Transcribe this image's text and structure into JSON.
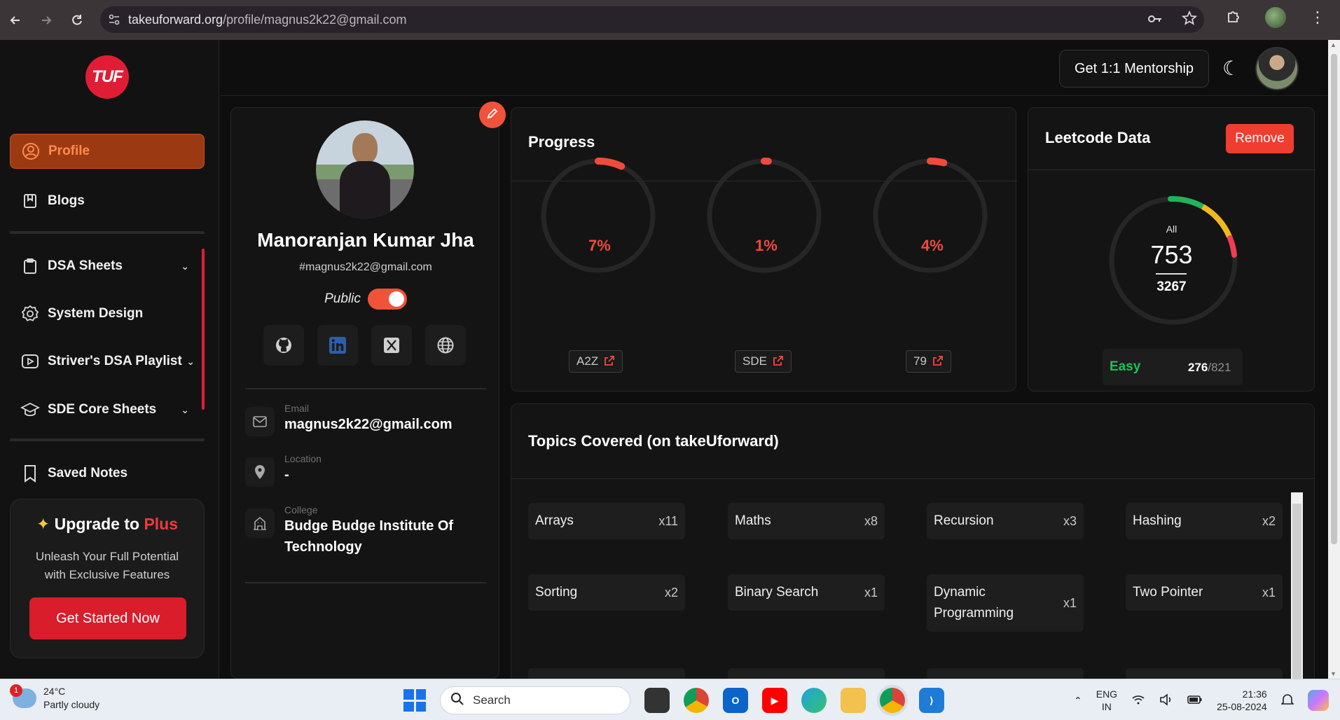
{
  "browser": {
    "url_host": "takeuforward.org",
    "url_path": "/profile/magnus2k22@gmail.com"
  },
  "sidebar": {
    "logo_text": "TUF",
    "items": [
      {
        "label": "Profile",
        "icon": "user-circle-icon"
      },
      {
        "label": "Blogs",
        "icon": "book-icon"
      },
      {
        "label": "DSA Sheets",
        "icon": "clipboard-icon"
      },
      {
        "label": "System Design",
        "icon": "gear-icon"
      },
      {
        "label": "Striver's DSA Playlist",
        "icon": "play-icon"
      },
      {
        "label": "SDE Core Sheets",
        "icon": "graduation-cap-icon"
      },
      {
        "label": "Saved Notes",
        "icon": "bookmark-icon"
      }
    ],
    "upgrade": {
      "title_prefix": "Upgrade to",
      "title_highlight": "Plus",
      "description": "Unleash Your Full Potential with Exclusive Features",
      "cta": "Get Started Now"
    }
  },
  "header": {
    "mentorship_label": "Get 1:1 Mentorship"
  },
  "profile": {
    "name": "Manoranjan Kumar Jha",
    "handle": "#magnus2k22@gmail.com",
    "visibility_label": "Public",
    "visibility_on": true,
    "email_caption": "Email",
    "email": "magnus2k22@gmail.com",
    "location_caption": "Location",
    "location": "-",
    "college_caption": "College",
    "college": "Budge Budge Institute Of Technology"
  },
  "progress": {
    "title": "Progress",
    "items": [
      {
        "percent_label": "7%",
        "value": 7,
        "tag": "A2Z"
      },
      {
        "percent_label": "1%",
        "value": 1,
        "tag": "SDE"
      },
      {
        "percent_label": "4%",
        "value": 4,
        "tag": "79"
      }
    ],
    "accent": "#ef4b3c"
  },
  "leetcode": {
    "title": "Leetcode Data",
    "remove_label": "Remove",
    "all_label": "All",
    "solved": "753",
    "total": "3267",
    "easy_label": "Easy",
    "easy_solved": "276",
    "easy_total": "/821"
  },
  "topics": {
    "title": "Topics Covered (on takeUforward)",
    "items": [
      {
        "name": "Arrays",
        "count": "x11"
      },
      {
        "name": "Maths",
        "count": "x8"
      },
      {
        "name": "Recursion",
        "count": "x3"
      },
      {
        "name": "Hashing",
        "count": "x2"
      },
      {
        "name": "Sorting",
        "count": "x2"
      },
      {
        "name": "Binary Search",
        "count": "x1"
      },
      {
        "name": "Dynamic Programming",
        "count": "x1"
      },
      {
        "name": "Two Pointer",
        "count": "x1"
      }
    ]
  },
  "taskbar": {
    "weather_badge": "1",
    "temperature": "24°C",
    "condition": "Partly cloudy",
    "search_label": "Search",
    "lang_line1": "ENG",
    "lang_line2": "IN",
    "time": "21:36",
    "date": "25-08-2024"
  }
}
